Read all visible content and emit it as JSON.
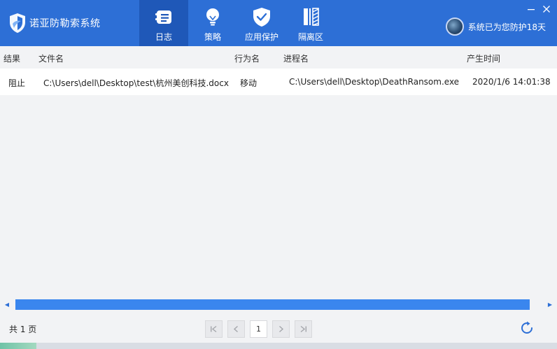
{
  "app": {
    "title": "诺亚防勒索系统",
    "status": "系统已为您防护18天"
  },
  "nav": [
    {
      "label": "日志",
      "icon": "log-icon",
      "active": true
    },
    {
      "label": "策略",
      "icon": "lightbulb-icon",
      "active": false
    },
    {
      "label": "应用保护",
      "icon": "shield-check-icon",
      "active": false
    },
    {
      "label": "隔离区",
      "icon": "quarantine-icon",
      "active": false
    }
  ],
  "table": {
    "headers": {
      "result": "结果",
      "filename": "文件名",
      "action": "行为名",
      "process": "进程名",
      "time": "产生时间"
    },
    "rows": [
      {
        "result": "阻止",
        "filename": "C:\\Users\\dell\\Desktop\\test\\杭州美创科技.docx",
        "action": "移动",
        "process": "C:\\Users\\dell\\Desktop\\DeathRansom.exe",
        "time": "2020/1/6 14:01:38"
      }
    ]
  },
  "pagination": {
    "total_label": "共 1 页",
    "current_page": "1"
  },
  "colors": {
    "header": "#2d6fd6",
    "active_tab": "#1f58b8",
    "scroll_thumb": "#3a86ee"
  }
}
